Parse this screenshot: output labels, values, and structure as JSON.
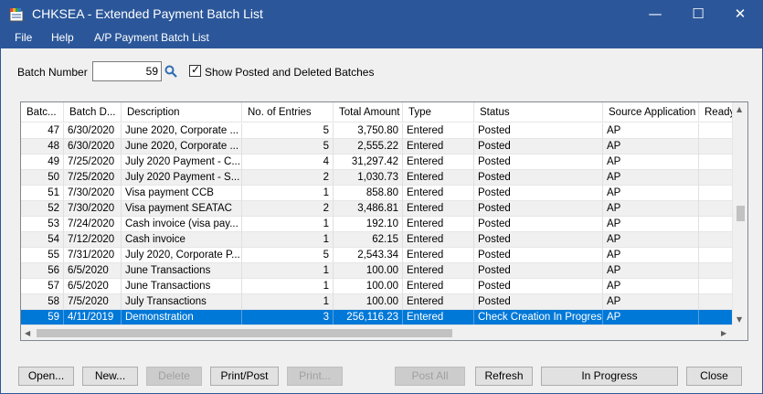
{
  "window": {
    "title": "CHKSEA - Extended Payment Batch List",
    "controls": {
      "minimize": "—",
      "maximize": "☐",
      "close": "✕"
    }
  },
  "menu": [
    "File",
    "Help",
    "A/P Payment Batch List"
  ],
  "filters": {
    "batch_number_label": "Batch Number",
    "batch_number_value": "59",
    "show_posted_label": "Show Posted and Deleted Batches",
    "show_posted_checked": "✓"
  },
  "grid": {
    "columns": [
      "Batc...",
      "Batch D...",
      "Description",
      "No. of Entries",
      "Total Amount",
      "Type",
      "Status",
      "Source Application",
      "Ready To P"
    ],
    "rows": [
      [
        "47",
        "6/30/2020",
        "June 2020, Corporate ...",
        "5",
        "3,750.80",
        "Entered",
        "Posted",
        "AP"
      ],
      [
        "48",
        "6/30/2020",
        "June 2020, Corporate ...",
        "5",
        "2,555.22",
        "Entered",
        "Posted",
        "AP"
      ],
      [
        "49",
        "7/25/2020",
        "July 2020 Payment - C...",
        "4",
        "31,297.42",
        "Entered",
        "Posted",
        "AP"
      ],
      [
        "50",
        "7/25/2020",
        "July 2020 Payment - S...",
        "2",
        "1,030.73",
        "Entered",
        "Posted",
        "AP"
      ],
      [
        "51",
        "7/30/2020",
        "Visa payment CCB",
        "1",
        "858.80",
        "Entered",
        "Posted",
        "AP"
      ],
      [
        "52",
        "7/30/2020",
        "Visa payment SEATAC",
        "2",
        "3,486.81",
        "Entered",
        "Posted",
        "AP"
      ],
      [
        "53",
        "7/24/2020",
        "Cash invoice (visa pay...",
        "1",
        "192.10",
        "Entered",
        "Posted",
        "AP"
      ],
      [
        "54",
        "7/12/2020",
        "Cash invoice",
        "1",
        "62.15",
        "Entered",
        "Posted",
        "AP"
      ],
      [
        "55",
        "7/31/2020",
        "July 2020, Corporate P...",
        "5",
        "2,543.34",
        "Entered",
        "Posted",
        "AP"
      ],
      [
        "56",
        "6/5/2020",
        "June Transactions",
        "1",
        "100.00",
        "Entered",
        "Posted",
        "AP"
      ],
      [
        "57",
        "6/5/2020",
        "June Transactions",
        "1",
        "100.00",
        "Entered",
        "Posted",
        "AP"
      ],
      [
        "58",
        "7/5/2020",
        "July Transactions",
        "1",
        "100.00",
        "Entered",
        "Posted",
        "AP"
      ],
      [
        "59",
        "4/11/2019",
        "Demonstration",
        "3",
        "256,116.23",
        "Entered",
        "Check Creation In Progress",
        "AP"
      ]
    ],
    "selected_row": 12
  },
  "buttons": {
    "open": "Open...",
    "new": "New...",
    "delete": "Delete",
    "print_post": "Print/Post",
    "print": "Print...",
    "post_all": "Post All",
    "refresh": "Refresh",
    "in_progress": "In Progress",
    "close": "Close"
  },
  "colors": {
    "titlebar": "#2b579a",
    "selection": "#0078d7"
  }
}
